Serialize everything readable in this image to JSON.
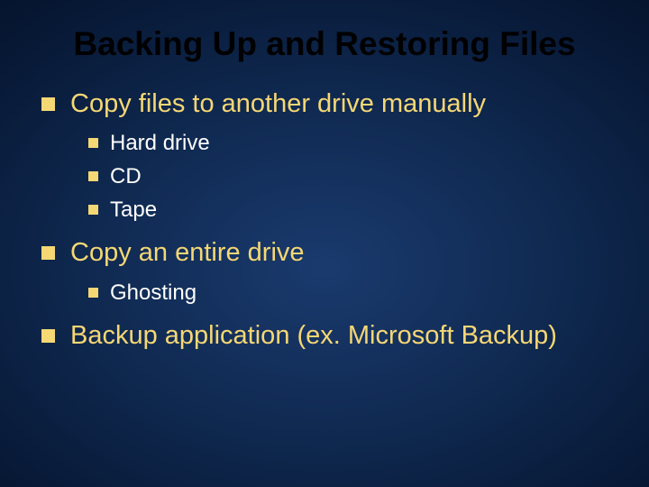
{
  "slide": {
    "title": "Backing Up and Restoring Files",
    "bullets": [
      {
        "text": "Copy files to another drive manually",
        "sub": [
          {
            "text": "Hard drive"
          },
          {
            "text": "CD"
          },
          {
            "text": "Tape"
          }
        ]
      },
      {
        "text": "Copy an entire drive",
        "sub": [
          {
            "text": "Ghosting"
          }
        ]
      },
      {
        "text": "Backup application (ex. Microsoft Backup)",
        "sub": []
      }
    ]
  }
}
